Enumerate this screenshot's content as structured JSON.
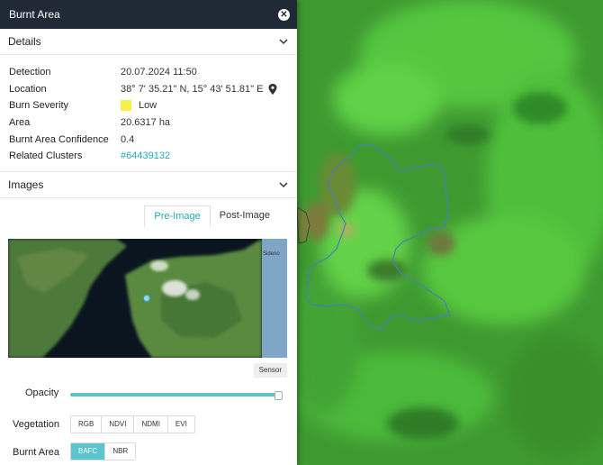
{
  "panel": {
    "title": "Burnt Area",
    "close_icon": "close-icon"
  },
  "details": {
    "header": "Details",
    "rows": [
      {
        "key": "Detection",
        "value": "20.07.2024 11:50"
      },
      {
        "key": "Location",
        "value": "38° 7' 35.21\" N, 15° 43' 51.81\" E"
      },
      {
        "key": "Burn Severity",
        "value": "Low"
      },
      {
        "key": "Area",
        "value": "20.6317 ha"
      },
      {
        "key": "Burnt Area Confidence",
        "value": "0.4"
      },
      {
        "key": "Related Clusters",
        "value": "#64439132"
      }
    ],
    "severity_color": "#f7f04a"
  },
  "images": {
    "header": "Images",
    "tabs": [
      "Pre-Image",
      "Post-Image"
    ],
    "active_tab": "Pre-Image",
    "map_label": "Sideno",
    "sensor_label": "Sensor"
  },
  "controls": {
    "opacity_label": "Opacity",
    "opacity_value": 1.0,
    "vegetation_label": "Vegetation",
    "vegetation_options": [
      "RGB",
      "NDVI",
      "NDMI",
      "EVI"
    ],
    "burnt_area_label": "Burnt Area",
    "burnt_area_options": [
      "BAFC",
      "NBR"
    ],
    "burnt_area_selected": "BAFC"
  },
  "colors": {
    "accent": "#2aa7b5",
    "titlebar": "#1f2a36",
    "boundary": "#4a7fb5"
  }
}
